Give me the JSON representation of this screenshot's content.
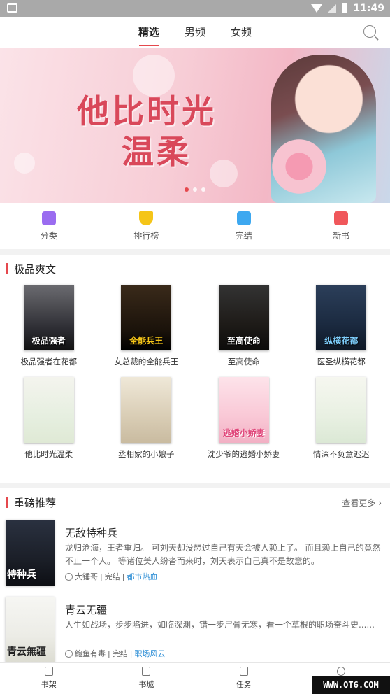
{
  "status_bar": {
    "time": "11:49"
  },
  "header": {
    "tabs": [
      {
        "label": "精选",
        "active": true
      },
      {
        "label": "男频",
        "active": false
      },
      {
        "label": "女频",
        "active": false
      }
    ],
    "search_icon": "search-icon"
  },
  "banner": {
    "title_line1": "他比时光",
    "title_line2": "温柔",
    "dots": 3,
    "active_dot": 0
  },
  "quick_nav": [
    {
      "label": "分类",
      "icon": "bag-icon",
      "color": "#9a6cf0"
    },
    {
      "label": "排行榜",
      "icon": "trophy-icon",
      "color": "#f5c518"
    },
    {
      "label": "完结",
      "icon": "box-icon",
      "color": "#3da8f0"
    },
    {
      "label": "新书",
      "icon": "book-icon",
      "color": "#f0575b"
    }
  ],
  "section_premium": {
    "title": "极品爽文",
    "books": [
      {
        "title": "极品强者在花都",
        "cover_text": "极品强者"
      },
      {
        "title": "女总裁的全能兵王",
        "cover_text": "全能兵王"
      },
      {
        "title": "至高使命",
        "cover_text": "至高使命"
      },
      {
        "title": "医圣纵横花都",
        "cover_text": "纵横花都"
      },
      {
        "title": "他比时光温柔",
        "cover_text": ""
      },
      {
        "title": "丞相家的小娘子",
        "cover_text": ""
      },
      {
        "title": "沈少爷的逃婚小娇妻",
        "cover_text": "逃婚小娇妻"
      },
      {
        "title": "情深不负意迟迟",
        "cover_text": ""
      }
    ]
  },
  "section_recommend": {
    "title": "重磅推荐",
    "more_label": "查看更多",
    "items": [
      {
        "title": "无敌特种兵",
        "desc": "龙归沧海，王者重归。 可刘天却没想过自己有天会被人赖上了。 而且赖上自己的竟然不止一个人。 等诸位美人纷沓而来时，刘天表示自己真不是故意的。",
        "author": "大锤哥",
        "status": "完结",
        "genre": "都市热血",
        "cover_text": "特种兵"
      },
      {
        "title": "青云无疆",
        "desc": "人生如战场，步步陷进，如临深渊，错一步尸骨无寒，看一个草根的职场奋斗史......",
        "author": "鲍鱼有毒",
        "status": "完结",
        "genre": "职场风云",
        "cover_text": "青云無疆"
      }
    ]
  },
  "bottom_nav": [
    {
      "label": "书架",
      "icon": "bookshelf-icon"
    },
    {
      "label": "书城",
      "icon": "home-icon"
    },
    {
      "label": "任务",
      "icon": "task-icon"
    },
    {
      "label": "",
      "icon": "profile-icon"
    }
  ],
  "watermark": "WWW.QT6.COM",
  "colors": {
    "accent": "#e5484d",
    "link": "#2f8fd6"
  }
}
